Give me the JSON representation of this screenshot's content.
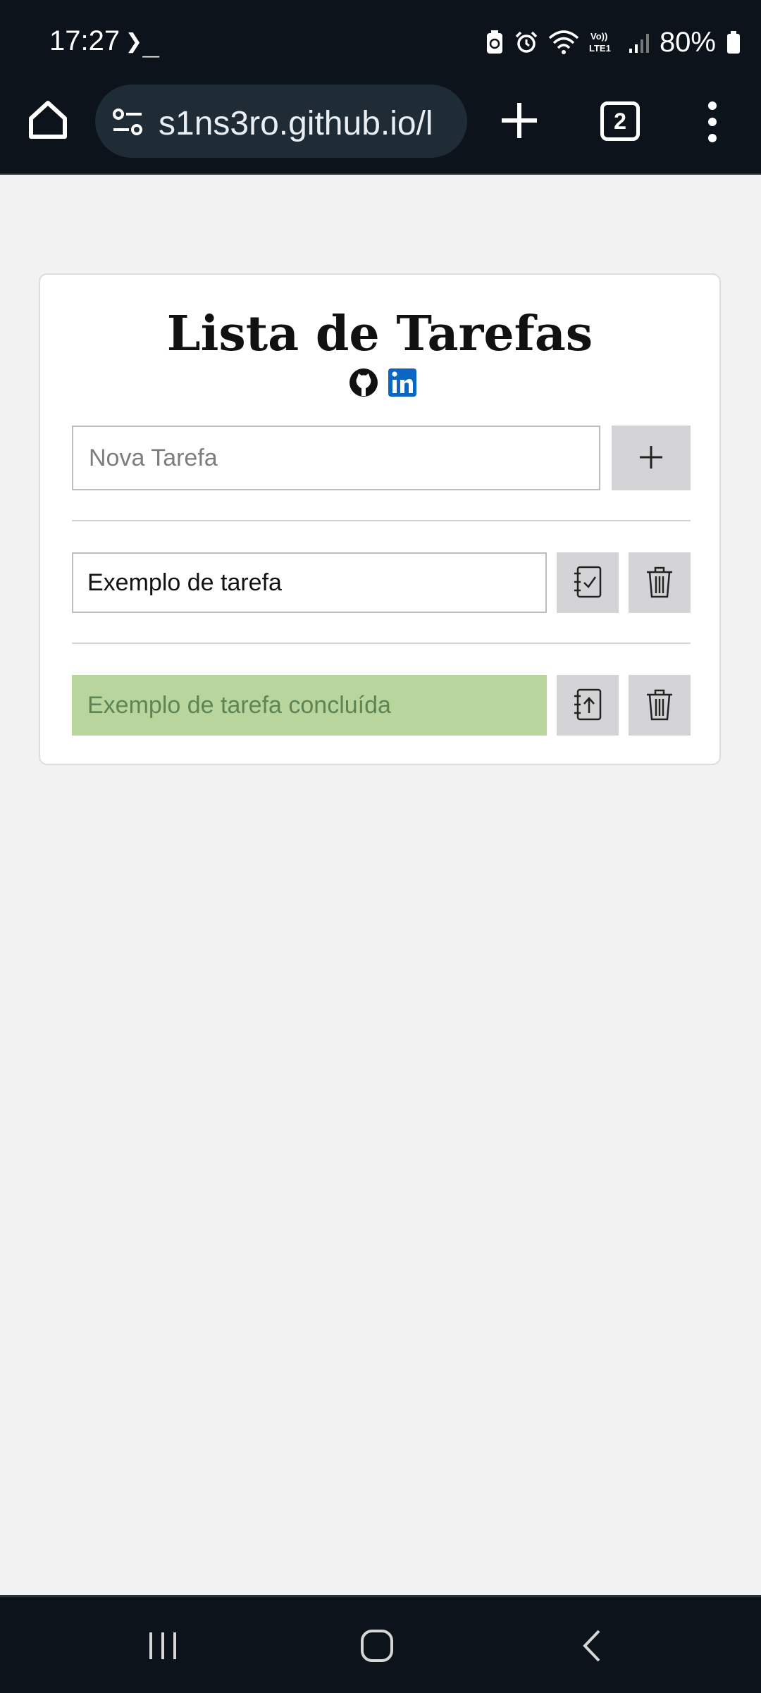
{
  "status_bar": {
    "time": "17:27",
    "terminal_glyph": "❯_",
    "battery_text": "80%"
  },
  "browser": {
    "url": "s1ns3ro.github.io/l",
    "tab_count": "2"
  },
  "app": {
    "title": "Lista de Tarefas",
    "new_task_placeholder": "Nova Tarefa",
    "new_task_value": "",
    "add_icon": "plus-icon",
    "tasks": [
      {
        "text": "Exemplo de tarefa",
        "done": false,
        "action_icon": "checklist-icon",
        "delete_icon": "trash-icon"
      },
      {
        "text": "Exemplo de tarefa concluída",
        "done": true,
        "action_icon": "upload-icon",
        "delete_icon": "trash-icon"
      }
    ]
  },
  "colors": {
    "system_bar": "#0d131a",
    "page_bg": "#f2f2f2",
    "button_bg": "#d4d4d6",
    "done_bg": "#b8d59e",
    "done_text": "#5e8454",
    "linkedin_blue": "#0a66c2"
  }
}
